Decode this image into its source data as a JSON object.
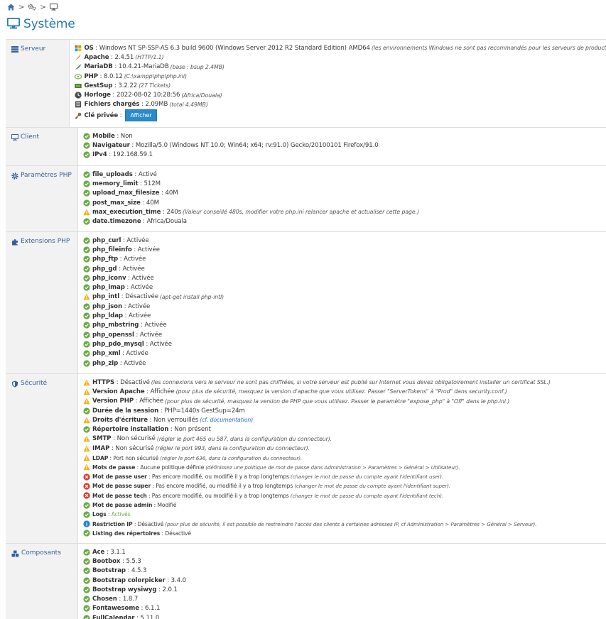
{
  "breadcrumb": {
    "sep": ">"
  },
  "page_title": "Système",
  "colors": {
    "accent": "#2679b5",
    "ok": "#69aa46",
    "warn": "#f8ae0e",
    "error": "#dd3a2f",
    "info": "#2283c5",
    "button": "#2a8bcb"
  },
  "sections": {
    "serveur": {
      "label": "Serveur",
      "os": {
        "name": "OS",
        "value": "Windows NT SP-SSP-AS 6.3 build 9600 (Windows Server 2012 R2 Standard Edition) AMD64",
        "note": "(les environnements Windows ne sont pas recommandés pour les serveurs de production)"
      },
      "apache": {
        "name": "Apache",
        "value": "2.4.51",
        "note": "(HTTP/1.1)"
      },
      "mariadb": {
        "name": "MariaDB",
        "value": "10.4.21-MariaDB",
        "note": "(base : bsup 2.4MB)"
      },
      "php": {
        "name": "PHP",
        "value": "8.0.12",
        "note": "(C:\\xampp\\php\\php.ini)"
      },
      "gestsup": {
        "name": "GestSup",
        "value": "3.2.22",
        "note": "(27 Tickets)"
      },
      "horloge": {
        "name": "Horloge",
        "value": "2022-08-02 10:28:56",
        "note": "(Africa/Douala)"
      },
      "fichiers": {
        "name": "Fichiers chargés",
        "value": "2.09MB",
        "note": "(total 4.49MB)"
      },
      "cle": {
        "name": "Clé privée",
        "button": "Afficher"
      }
    },
    "client": {
      "label": "Client",
      "mobile": {
        "name": "Mobile",
        "value": "Non"
      },
      "navigateur": {
        "name": "Navigateur",
        "value": "Mozilla/5.0 (Windows NT 10.0; Win64; x64; rv:91.0) Gecko/20100101 Firefox/91.0"
      },
      "ipv4": {
        "name": "IPv4",
        "value": "192.168.59.1"
      }
    },
    "php_params": {
      "label": "Paramètres PHP",
      "items": [
        {
          "name": "file_uploads",
          "value": "Activé",
          "status": "ok"
        },
        {
          "name": "memory_limit",
          "value": "512M",
          "status": "ok"
        },
        {
          "name": "upload_max_filesize",
          "value": "40M",
          "status": "ok"
        },
        {
          "name": "post_max_size",
          "value": "40M",
          "status": "ok"
        },
        {
          "name": "max_execution_time",
          "value": "240s",
          "note": "(Valeur conseillé 480s, modifier votre php.ini relancer apache et actualiser cette page.)",
          "status": "warn"
        },
        {
          "name": "date.timezone",
          "value": "Africa/Douala",
          "status": "ok"
        }
      ]
    },
    "php_ext": {
      "label": "Extensions PHP",
      "items": [
        {
          "name": "php_curl",
          "value": "Activée",
          "status": "ok"
        },
        {
          "name": "php_fileinfo",
          "value": "Activée",
          "status": "ok"
        },
        {
          "name": "php_ftp",
          "value": "Activée",
          "status": "ok"
        },
        {
          "name": "php_gd",
          "value": "Activée",
          "status": "ok"
        },
        {
          "name": "php_iconv",
          "value": "Activée",
          "status": "ok"
        },
        {
          "name": "php_imap",
          "value": "Activée",
          "status": "ok"
        },
        {
          "name": "php_intl",
          "value": "Désactivée",
          "note": "(apt-get install php-intl)",
          "status": "warn"
        },
        {
          "name": "php_json",
          "value": "Activée",
          "status": "ok"
        },
        {
          "name": "php_ldap",
          "value": "Activée",
          "status": "ok"
        },
        {
          "name": "php_mbstring",
          "value": "Activée",
          "status": "ok"
        },
        {
          "name": "php_openssl",
          "value": "Activée",
          "status": "ok"
        },
        {
          "name": "php_pdo_mysql",
          "value": "Activée",
          "status": "ok"
        },
        {
          "name": "php_xml",
          "value": "Activée",
          "status": "ok"
        },
        {
          "name": "php_zip",
          "value": "Activée",
          "status": "ok"
        }
      ]
    },
    "securite": {
      "label": "Sécurité",
      "items": [
        {
          "name": "HTTPS",
          "value": "Désactivé",
          "note": "(les connexions vers le serveur ne sont pas chiffrées, si votre serveur est publié sur Internet vous devez obligatoirement installer un certificat SSL.)",
          "status": "warn"
        },
        {
          "name": "Version Apache",
          "value": "Affichée",
          "note": "(pour plus de sécurité, masquez la version d'apache que vous utilisez. Passer \"ServerTokens\" à \"Prod\" dans security.conf.)",
          "status": "warn"
        },
        {
          "name": "Version PHP",
          "value": "Affichée",
          "note": "(pour plus de sécurité, masquez la version de PHP que vous utilisez. Passer le paramètre \"expose_php\" à \"Off\" dans le php.ini.)",
          "status": "warn"
        },
        {
          "name": "Durée de la session",
          "value": "PHP=1440s GestSup=24m",
          "status": "ok"
        },
        {
          "name": "Droits d'écriture",
          "value": "Non verrouillés",
          "note": "(cf. documentation)",
          "status": "warn",
          "link": true
        },
        {
          "name": "Répertoire installation",
          "value": "Non présent",
          "status": "ok"
        },
        {
          "name": "SMTP",
          "value": "Non sécurisé",
          "note": "(régler le port 465 ou 587, dans la configuration du connecteur).",
          "status": "warn"
        },
        {
          "name": "IMAP",
          "value": "Non sécurisé",
          "note": "(régler le port 993, dans la configuration du connecteur).",
          "status": "warn"
        },
        {
          "name": "LDAP",
          "value": "Port non sécurisé",
          "note": "(régler le port 636, dans la configuration du connecteur).",
          "status": "warn",
          "small": true
        },
        {
          "name": "Mots de passe",
          "value": "Aucune politique définie",
          "note": "(définissez une politique de mot de passe dans Administration > Paramètres > Général > Utilisateur).",
          "status": "warn",
          "small": true
        },
        {
          "name": "Mot de passe user",
          "value": "Pas encore modifié, ou modifié il y a trop longtemps",
          "note": "(changer le mot de passe du compte ayant l'identifiant user).",
          "status": "error",
          "small": true
        },
        {
          "name": "Mot de passe super",
          "value": "Pas encore modifié, ou modifié il y a trop longtemps",
          "note": "(changer le mot de passe du compte ayant l'identifiant super).",
          "status": "error",
          "small": true
        },
        {
          "name": "Mot de passe tech",
          "value": "Pas encore modifié, ou modifié il y a trop longtemps",
          "note": "(changer le mot de passe du compte ayant l'identifiant tech).",
          "status": "error",
          "small": true
        },
        {
          "name": "Mot de passe admin",
          "value": "Modifié",
          "status": "ok",
          "small": true
        },
        {
          "name": "Logs",
          "value": "Activés",
          "status": "ok",
          "small": true,
          "green": true
        },
        {
          "name": "Restriction IP",
          "value": "Désactivé",
          "note": "(pour plus de sécurité, il est possible de restreindre l'accès des clients à certaines adresses IP, cf Administration > Paramètres > Général > Serveur).",
          "status": "info",
          "small": true
        },
        {
          "name": "Listing des répertoires",
          "value": "Désactivé",
          "status": "ok",
          "small": true
        }
      ]
    },
    "composants": {
      "label": "Composants",
      "items": [
        {
          "name": "Ace",
          "value": "3.1.1",
          "status": "ok"
        },
        {
          "name": "Bootbox",
          "value": "5.5.3",
          "status": "ok"
        },
        {
          "name": "Bootstrap",
          "value": "4.5.3",
          "status": "ok"
        },
        {
          "name": "Bootstrap colorpicker",
          "value": "3.4.0",
          "status": "ok"
        },
        {
          "name": "Bootstrap wysiwyg",
          "value": "2.0.1",
          "status": "ok"
        },
        {
          "name": "Chosen",
          "value": "1.8.7",
          "status": "ok"
        },
        {
          "name": "Fontawesome",
          "value": "6.1.1",
          "status": "ok"
        },
        {
          "name": "FullCalendar",
          "value": "5.11.0",
          "status": "ok"
        }
      ]
    }
  }
}
